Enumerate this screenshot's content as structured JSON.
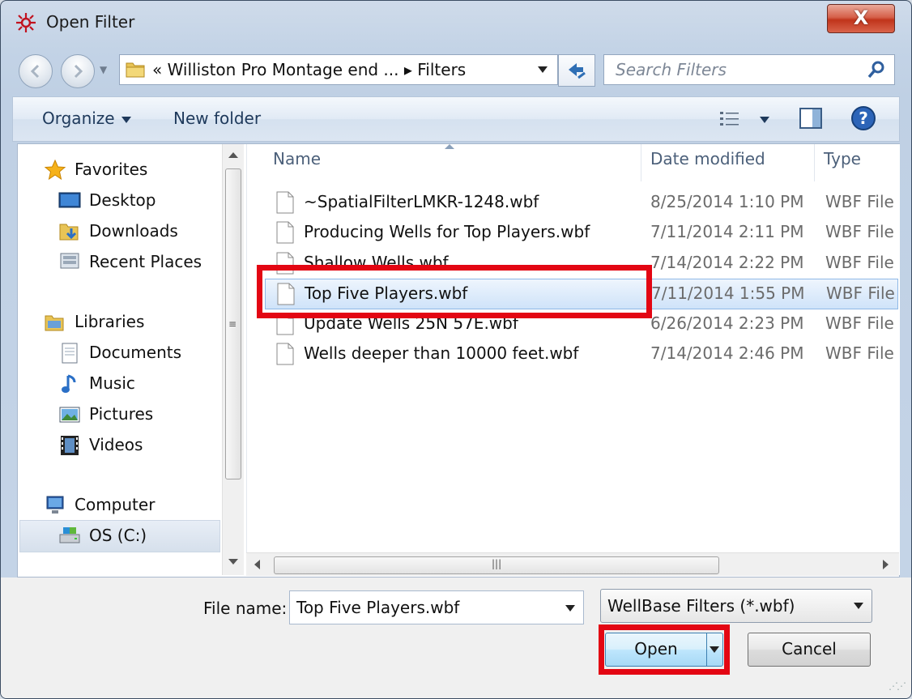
{
  "window": {
    "title": "Open Filter",
    "close_label": "X"
  },
  "navigation": {
    "address_path": "« Williston Pro Montage end ... ▸ Filters",
    "search_placeholder": "Search Filters"
  },
  "toolbar": {
    "organize_label": "Organize",
    "new_folder_label": "New folder"
  },
  "nav_pane": {
    "favorites_label": "Favorites",
    "favorites": [
      {
        "label": "Desktop",
        "icon": "desktop-icon"
      },
      {
        "label": "Downloads",
        "icon": "downloads-icon"
      },
      {
        "label": "Recent Places",
        "icon": "recent-places-icon"
      }
    ],
    "libraries_label": "Libraries",
    "libraries": [
      {
        "label": "Documents",
        "icon": "documents-icon"
      },
      {
        "label": "Music",
        "icon": "music-icon"
      },
      {
        "label": "Pictures",
        "icon": "pictures-icon"
      },
      {
        "label": "Videos",
        "icon": "videos-icon"
      }
    ],
    "computer_label": "Computer",
    "drives": [
      {
        "label": "OS (C:)",
        "icon": "drive-icon",
        "selected": true
      }
    ]
  },
  "file_list": {
    "columns": [
      "Name",
      "Date modified",
      "Type"
    ],
    "rows": [
      {
        "name": "~SpatialFilterLMKR-1248.wbf",
        "date": "8/25/2014 1:10 PM",
        "type": "WBF File",
        "selected": false
      },
      {
        "name": "Producing Wells for Top Players.wbf",
        "date": "7/11/2014 2:11 PM",
        "type": "WBF File",
        "selected": false
      },
      {
        "name": "Shallow Wells.wbf",
        "date": "7/14/2014 2:22 PM",
        "type": "WBF File",
        "selected": false
      },
      {
        "name": "Top Five Players.wbf",
        "date": "7/11/2014 1:55 PM",
        "type": "WBF File",
        "selected": true
      },
      {
        "name": "Update Wells 25N 57E.wbf",
        "date": "6/26/2014 2:23 PM",
        "type": "WBF File",
        "selected": false
      },
      {
        "name": "Wells deeper than 10000 feet.wbf",
        "date": "7/14/2014 2:46 PM",
        "type": "WBF File",
        "selected": false
      }
    ]
  },
  "footer": {
    "file_name_label": "File name:",
    "file_name_value": "Top Five Players.wbf",
    "file_type_value": "WellBase Filters (*.wbf)",
    "open_label": "Open",
    "cancel_label": "Cancel"
  },
  "colors": {
    "highlight": "#e30613",
    "selection": "#cfe3f9",
    "toolbar_text": "#1e395b"
  }
}
